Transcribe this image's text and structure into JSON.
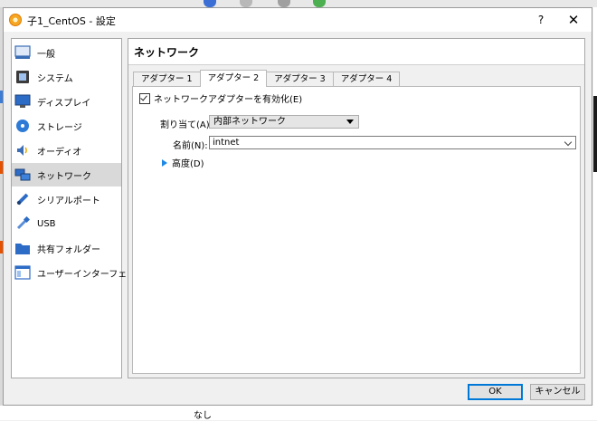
{
  "window": {
    "title": "子1_CentOS - 設定",
    "help_label": "?",
    "close_label": "✕"
  },
  "background": {
    "bottom_text": "なし"
  },
  "sidebar": {
    "items": [
      {
        "label": "一般",
        "icon": "general-icon"
      },
      {
        "label": "システム",
        "icon": "system-icon"
      },
      {
        "label": "ディスプレイ",
        "icon": "display-icon"
      },
      {
        "label": "ストレージ",
        "icon": "storage-icon"
      },
      {
        "label": "オーディオ",
        "icon": "audio-icon"
      },
      {
        "label": "ネットワーク",
        "icon": "network-icon",
        "selected": true
      },
      {
        "label": "シリアルポート",
        "icon": "serial-port-icon"
      },
      {
        "label": "USB",
        "icon": "usb-icon"
      },
      {
        "label": "共有フォルダー",
        "icon": "shared-folder-icon"
      },
      {
        "label": "ユーザーインターフェース",
        "icon": "user-interface-icon"
      }
    ]
  },
  "main": {
    "title": "ネットワーク",
    "tabs": [
      {
        "label": "アダプター 1"
      },
      {
        "label": "アダプター 2",
        "active": true
      },
      {
        "label": "アダプター 3"
      },
      {
        "label": "アダプター 4"
      }
    ],
    "enable_adapter": {
      "label": "ネットワークアダプターを有効化(E)",
      "checked": true
    },
    "attached_to": {
      "label": "割り当て(A):",
      "value": "内部ネットワーク"
    },
    "name": {
      "label": "名前(N):",
      "value": "intnet"
    },
    "advanced": {
      "label": "高度(D)"
    }
  },
  "buttons": {
    "ok": "OK",
    "cancel": "キャンセル"
  },
  "colors": {
    "accent": "#0078d7",
    "selected_bg": "#d9d9d9",
    "expand_arrow": "#1e88e5"
  }
}
